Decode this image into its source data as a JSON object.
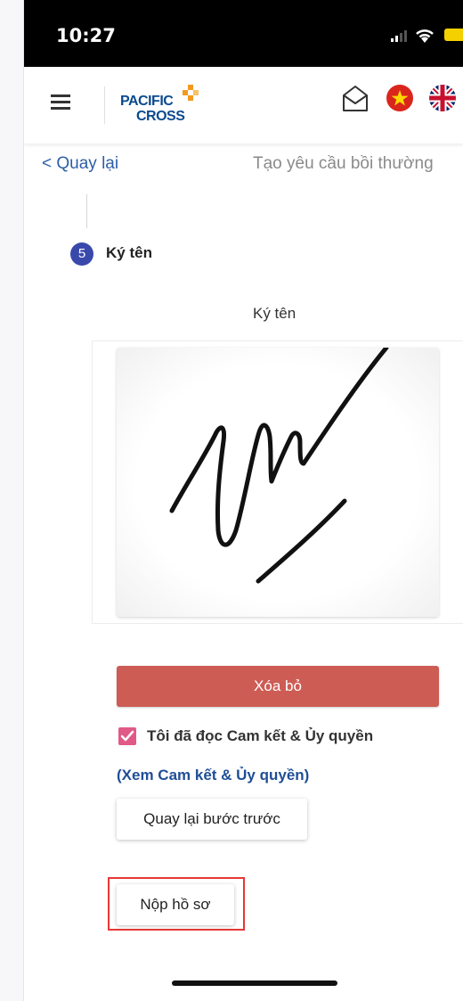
{
  "status_bar": {
    "time": "10:27"
  },
  "header": {
    "logo_line1": "PACIFIC",
    "logo_line2": "CROSS",
    "colors": {
      "brand_blue": "#0b4a8f",
      "logo_orange": "#f29a1f"
    }
  },
  "nav": {
    "back_label": "< Quay lại",
    "page_title": "Tạo yêu cầu bồi thường"
  },
  "step": {
    "number": "5",
    "label": "Ký tên"
  },
  "signature": {
    "label": "Ký tên"
  },
  "actions": {
    "clear_label": "Xóa bỏ",
    "agree_label": "Tôi đã đọc Cam kết & Ủy quyền",
    "agree_checked": true,
    "terms_link": "(Xem Cam kết & Ủy quyền)",
    "prev_label": "Quay lại bước trước",
    "submit_label": "Nộp hồ sơ"
  },
  "colors": {
    "accent": "#3949ab",
    "clear_button": "#cd5c54",
    "link": "#2d5fa8",
    "checkbox": "#e05a88",
    "highlight": "#e53935"
  },
  "icons": [
    "menu-icon",
    "mail-icon",
    "vietnam-flag-icon",
    "uk-flag-icon",
    "signal-icon",
    "wifi-icon",
    "battery-icon",
    "check-icon"
  ]
}
